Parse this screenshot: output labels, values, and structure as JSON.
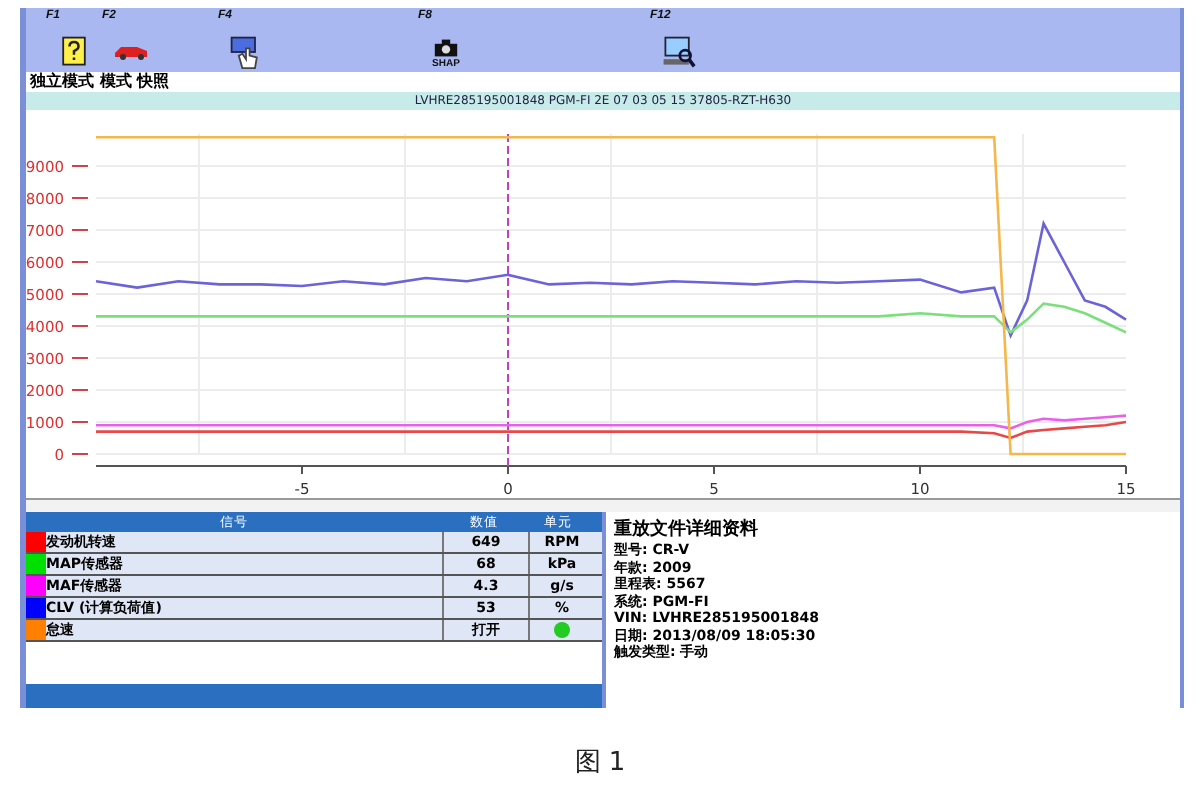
{
  "toolbar": {
    "buttons": [
      {
        "key": "F1",
        "kind": "help"
      },
      {
        "key": "F2",
        "kind": "car"
      },
      {
        "key": "F4",
        "kind": "hand"
      },
      {
        "key": "F8",
        "kind": "snap",
        "label": "SHAP"
      },
      {
        "key": "F12",
        "kind": "computer"
      }
    ]
  },
  "mode_bar": {
    "text": "独立模式 模式 快照"
  },
  "vin_bar": {
    "text": "LVHRE285195001848 PGM-FI 2E 07 03 05 15 37805-RZT-H630"
  },
  "chart": {
    "chart_data": {
      "type": "line",
      "xlim": [
        -10,
        15
      ],
      "ylim": [
        0,
        10000
      ],
      "xticks": [
        -5,
        0,
        5,
        10,
        15
      ],
      "grid": true,
      "ref_lines": [
        {
          "axis": "x",
          "value": 0,
          "color": "#c040c0"
        }
      ],
      "yticks": [
        0,
        1000,
        2000,
        3000,
        4000,
        5000,
        6000,
        7000,
        8000,
        9000
      ],
      "x": [
        -10,
        -9,
        -8,
        -7,
        -6,
        -5,
        -4,
        -3,
        -2,
        -1,
        0,
        1,
        2,
        3,
        4,
        5,
        6,
        7,
        8,
        9,
        10,
        11,
        11.8,
        12.2,
        12.6,
        13,
        13.5,
        14,
        14.5,
        15
      ],
      "series": [
        {
          "color": "#6b63d8",
          "values": [
            5400,
            5200,
            5400,
            5300,
            5300,
            5250,
            5400,
            5300,
            5500,
            5400,
            5600,
            5300,
            5350,
            5300,
            5400,
            5350,
            5300,
            5400,
            5350,
            5400,
            5450,
            5050,
            5200,
            3700,
            4800,
            7200,
            6000,
            4800,
            4600,
            4200
          ]
        },
        {
          "color": "#7be07b",
          "values": [
            4300,
            4300,
            4300,
            4300,
            4300,
            4300,
            4300,
            4300,
            4300,
            4300,
            4300,
            4300,
            4300,
            4300,
            4300,
            4300,
            4300,
            4300,
            4300,
            4300,
            4400,
            4300,
            4300,
            3800,
            4200,
            4700,
            4600,
            4400,
            4100,
            3800
          ]
        },
        {
          "color": "#e860e8",
          "values": [
            900,
            900,
            900,
            900,
            900,
            900,
            900,
            900,
            900,
            900,
            900,
            900,
            900,
            900,
            900,
            900,
            900,
            900,
            900,
            900,
            900,
            900,
            900,
            800,
            1000,
            1100,
            1050,
            1100,
            1150,
            1200
          ]
        },
        {
          "color": "#e84848",
          "values": [
            700,
            700,
            700,
            700,
            700,
            700,
            700,
            700,
            700,
            700,
            700,
            700,
            700,
            700,
            700,
            700,
            700,
            700,
            700,
            700,
            700,
            700,
            650,
            500,
            700,
            750,
            800,
            850,
            900,
            1000
          ]
        },
        {
          "color": "#f5b64a",
          "values": [
            9900,
            9900,
            9900,
            9900,
            9900,
            9900,
            9900,
            9900,
            9900,
            9900,
            9900,
            9900,
            9900,
            9900,
            9900,
            9900,
            9900,
            9900,
            9900,
            9900,
            9900,
            9900,
            9900,
            0,
            0,
            0,
            0,
            0,
            0,
            0
          ]
        }
      ]
    }
  },
  "signal_table": {
    "columns": [
      "信号",
      "数值",
      "单元"
    ],
    "rows": [
      {
        "color": "#ff0000",
        "name": "发动机转速",
        "value": "649",
        "kind": "text",
        "unit": "RPM"
      },
      {
        "color": "#00e000",
        "name": "MAP传感器",
        "value": "68",
        "kind": "text",
        "unit": "kPa"
      },
      {
        "color": "#ff00ff",
        "name": "MAF传感器",
        "value": "4.3",
        "kind": "text",
        "unit": "g/s"
      },
      {
        "color": "#0000ff",
        "name": "CLV (计算负荷值)",
        "value": "53",
        "kind": "text",
        "unit": "%"
      },
      {
        "color": "#ff8000",
        "name": "怠速",
        "value": "打开",
        "kind": "lamp",
        "lamp_on": true
      }
    ]
  },
  "details": {
    "title": "重放文件详细资料",
    "lines": [
      "型号: CR-V",
      "年款: 2009",
      "里程表: 5567",
      "系统: PGM-FI",
      "VIN: LVHRE285195001848",
      "日期: 2013/08/09 18:05:30",
      "触发类型: 手动"
    ]
  },
  "caption": "图 1"
}
